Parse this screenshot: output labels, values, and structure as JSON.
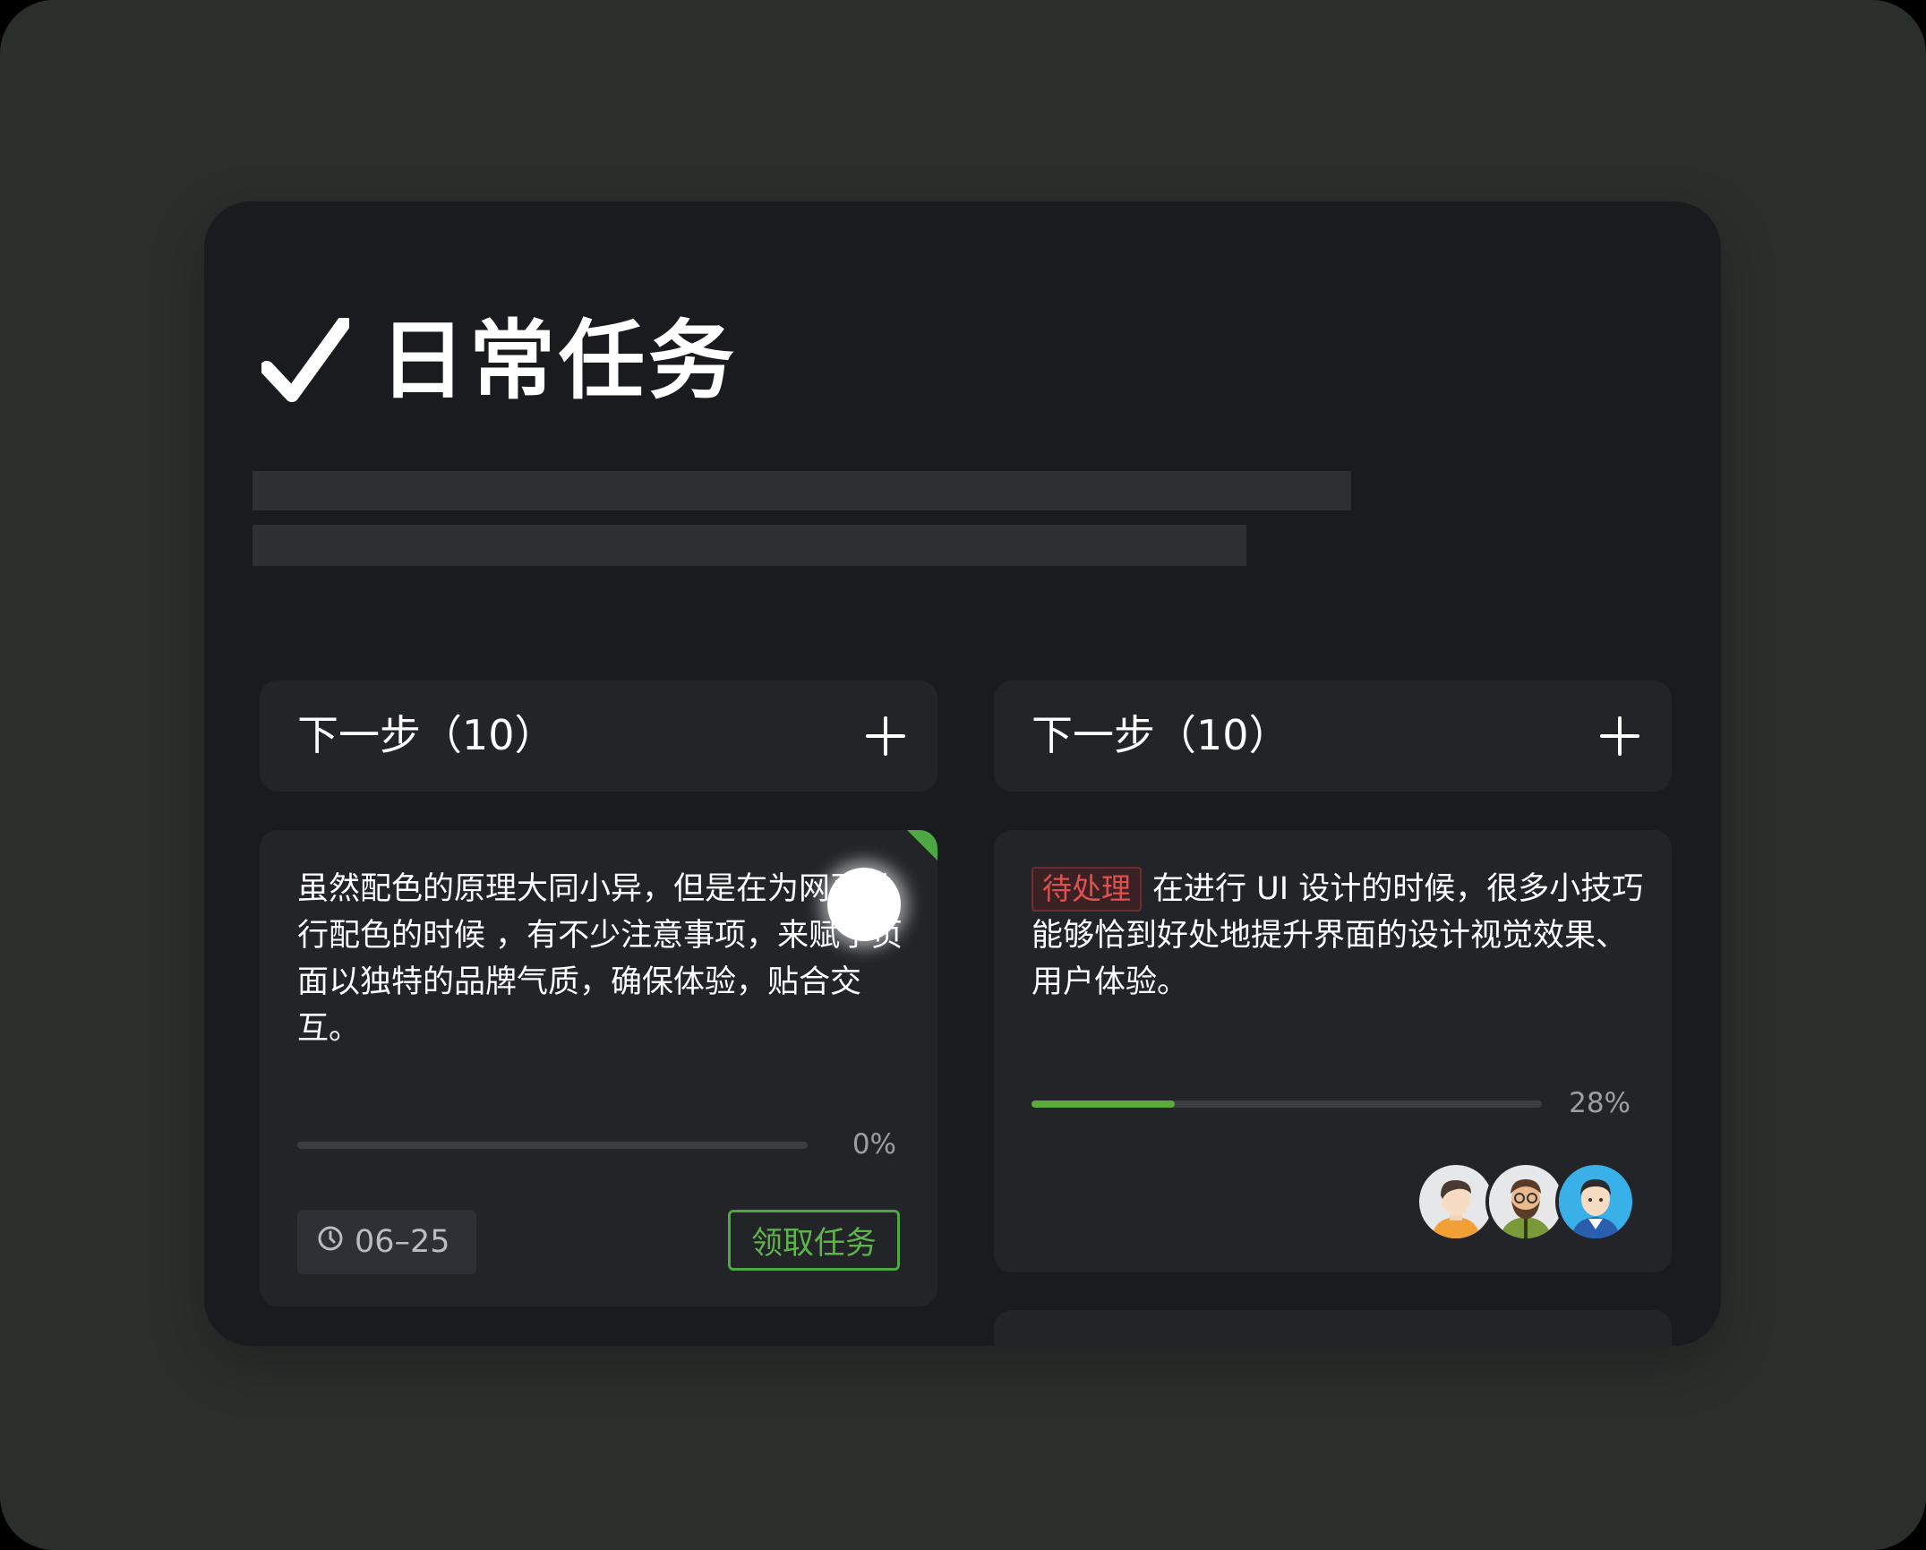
{
  "page": {
    "title": "日常任务",
    "title_icon": "check-icon"
  },
  "columns": [
    {
      "title": "下一步（10）",
      "add_icon": "plus-icon"
    },
    {
      "title": "下一步（10）",
      "add_icon": "plus-icon"
    }
  ],
  "cards": [
    {
      "text": "虽然配色的原理大同小异，但是在为网页进行配色的时候 ，有不少注意事项，来赋予页面以独特的品牌气质，确保体验，贴合交互。",
      "progress": 0,
      "progress_label": "0%",
      "date": "06–25",
      "date_icon": "clock-icon",
      "action_label": "领取任务",
      "corner_color": "#4da843"
    },
    {
      "status": "待处理",
      "text": "在进行 UI 设计的时候，很多小技巧能够恰到好处地提升界面的设计视觉效果、用户体验。",
      "progress": 0.28,
      "progress_label": "28%",
      "avatars": [
        "avatar-man-orange",
        "avatar-man-beard-glasses",
        "avatar-man-blue"
      ]
    }
  ],
  "colors": {
    "accent": "#5aaa3c",
    "status_red": "#e0504f",
    "panel_bg": "#1a1b1e",
    "card_bg": "#222428"
  }
}
